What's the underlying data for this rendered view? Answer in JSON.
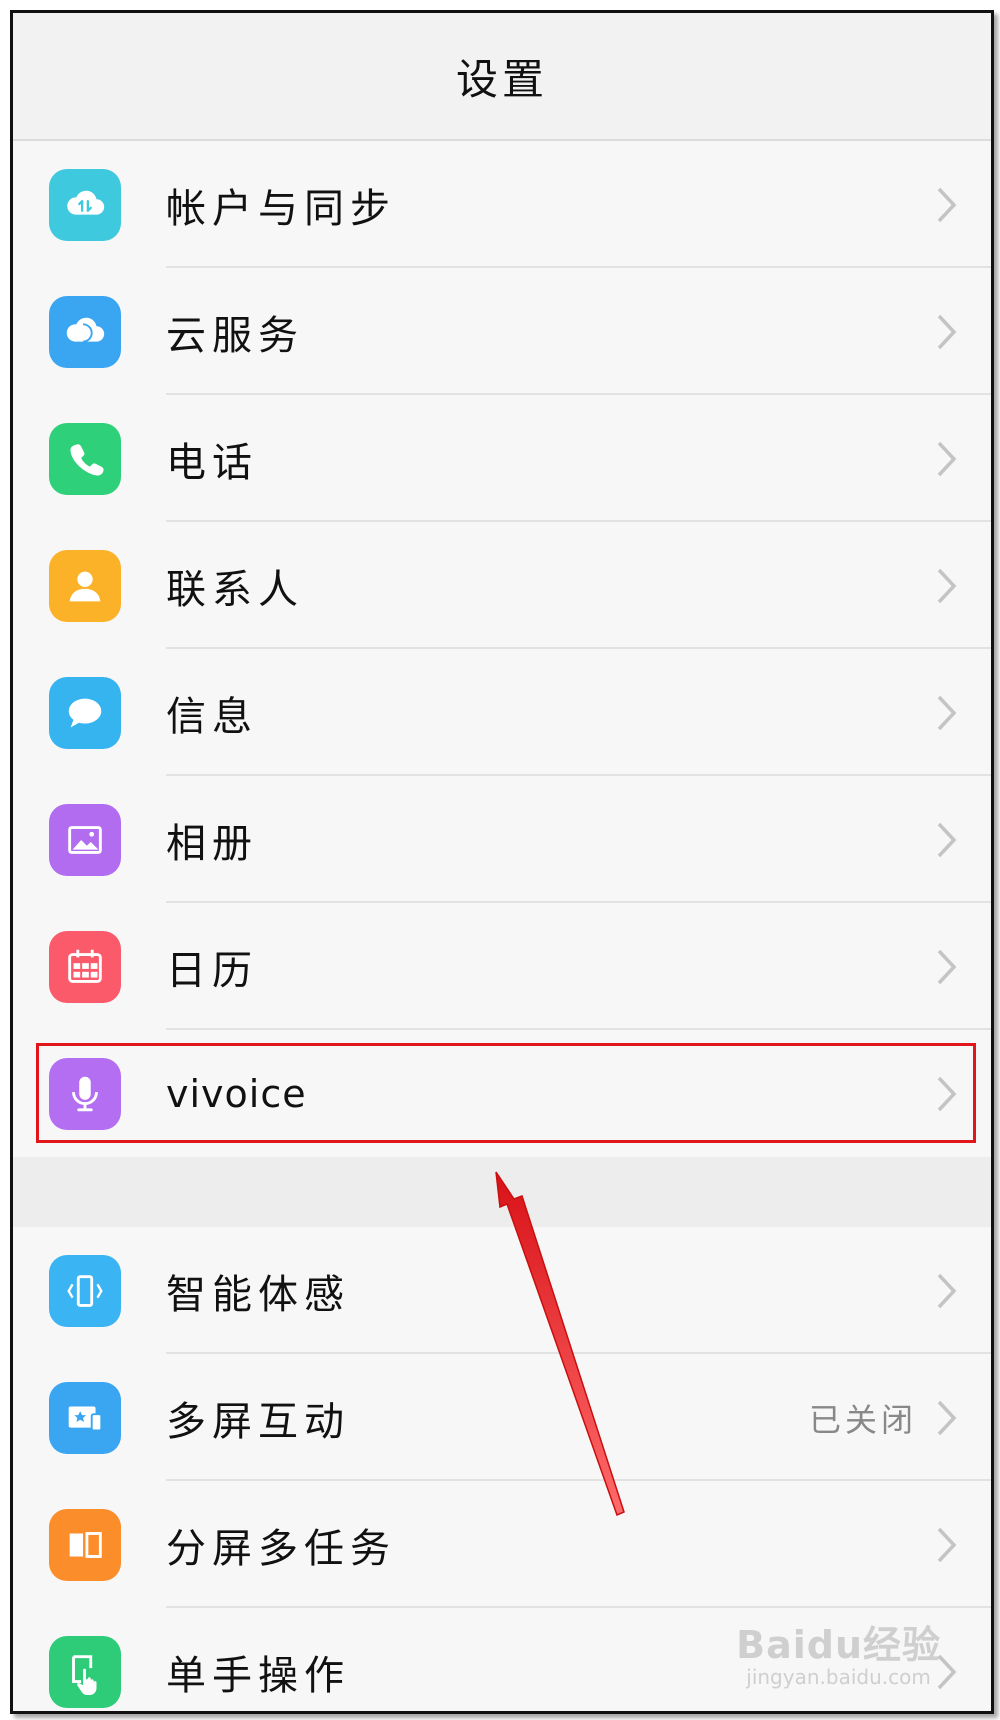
{
  "header": {
    "title": "设置"
  },
  "group1": [
    {
      "label": "帐户与同步",
      "icon": "cloud-sync-icon",
      "color": "#3fc9df"
    },
    {
      "label": "云服务",
      "icon": "cloud-icon",
      "color": "#3aa6f2"
    },
    {
      "label": "电话",
      "icon": "phone-icon",
      "color": "#2ed07a"
    },
    {
      "label": "联系人",
      "icon": "contact-icon",
      "color": "#fbb228"
    },
    {
      "label": "信息",
      "icon": "message-icon",
      "color": "#35b4f0"
    },
    {
      "label": "相册",
      "icon": "gallery-icon",
      "color": "#b26cf0"
    },
    {
      "label": "日历",
      "icon": "calendar-icon",
      "color": "#fb5a6b"
    },
    {
      "label": "vivoice",
      "icon": "microphone-icon",
      "color": "#b46ef2"
    }
  ],
  "group2": [
    {
      "label": "智能体感",
      "icon": "motion-phone-icon",
      "color": "#3bb4f3",
      "status": ""
    },
    {
      "label": "多屏互动",
      "icon": "multiscreen-icon",
      "color": "#3aa6f2",
      "status": "已关闭"
    },
    {
      "label": "分屏多任务",
      "icon": "split-screen-icon",
      "color": "#fb8d2a",
      "status": ""
    },
    {
      "label": "单手操作",
      "icon": "one-hand-icon",
      "color": "#2ecb78",
      "status": ""
    }
  ],
  "watermark": {
    "brand": "Baidu经验",
    "url": "jingyan.baidu.com"
  },
  "annotation": {
    "highlight_color": "#e0161b"
  }
}
